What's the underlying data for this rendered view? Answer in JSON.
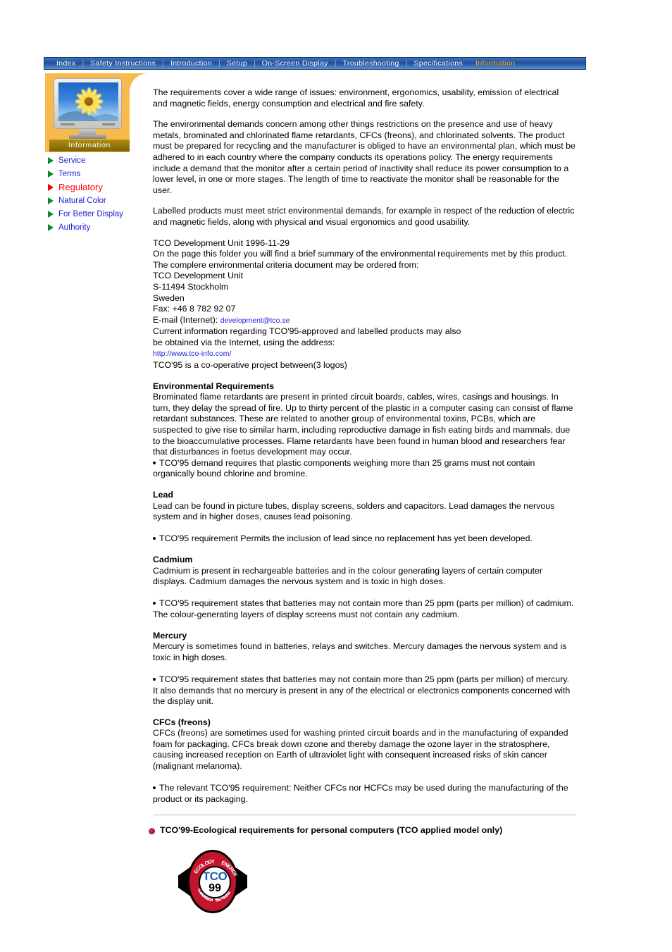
{
  "nav": {
    "items": [
      {
        "label": "Index",
        "active": false
      },
      {
        "label": "Safety Instructions",
        "active": false
      },
      {
        "label": "Introduction",
        "active": false
      },
      {
        "label": "Setup",
        "active": false
      },
      {
        "label": "On-Screen Display",
        "active": false
      },
      {
        "label": "Troubleshooting",
        "active": false
      },
      {
        "label": "Specifications",
        "active": false
      },
      {
        "label": "Information",
        "active": true
      }
    ],
    "separator": "|"
  },
  "sidebar": {
    "panel_label": "Information",
    "thumbnail_icon": "monitor-sunflower-icon",
    "items": [
      {
        "label": "Service",
        "current": false
      },
      {
        "label": "Terms",
        "current": false
      },
      {
        "label": "Regulatory",
        "current": true
      },
      {
        "label": "Natural Color",
        "current": false
      },
      {
        "label": "For Better Display",
        "current": false
      },
      {
        "label": "Authority",
        "current": false
      }
    ]
  },
  "content": {
    "p1": "The requirements cover a wide range of issues: environment, ergonomics, usability, emission of electrical and magnetic fields, energy consumption and electrical and fire safety.",
    "p2": "The environmental demands concern among other things restrictions on the presence and use of heavy metals, brominated and chlorinated flame retardants, CFCs (freons), and chlorinated solvents. The product must be prepared for recycling and the manufacturer is obliged to have an environmental plan, which must be adhered to in each country where the company conducts its operations policy. The energy requirements include a demand that the monitor after a certain period of inactivity shall reduce its power consumption to a lower level, in one or more stages. The length of time to reactivate the monitor shall be reasonable for the user.",
    "p3": "Labelled products must meet strict environmental demands, for example in respect of the reduction of electric and magnetic fields, along with physical and visual ergonomics and good usability.",
    "contact": {
      "l1": "TCO Development Unit 1996-11-29",
      "l2": "On the page this folder you will find a brief summary of the environmental requirements met by this product.",
      "l3": "The complere environmental criteria document may be ordered from:",
      "l4": "TCO Development Unit",
      "l5": "S-11494 Stockholm",
      "l6": "Sweden",
      "l7": "Fax: +46 8 782 92 07",
      "email_label": "E-mail (Internet): ",
      "email": "development@tco.se",
      "l8": "Current information regarding TCO'95-approved and labelled products may also",
      "l9": "be obtained via the Internet, using the address:",
      "url": "http://www.tco-info.com/",
      "l10": "TCO'95 is a co-operative project between(3 logos)"
    },
    "sections": [
      {
        "heading": "Environmental Requirements",
        "body": "Brominated flame retardants are present in printed circuit boards, cables, wires, casings and housings. In turn, they delay the spread of fire. Up to thirty percent of the plastic in a computer casing can consist of flame retardant substances. These are related to another group of environmental toxins, PCBs, which are suspected to give rise to similar harm, including reproductive damage in fish eating birds and mammals, due to the bioaccumulative processes. Flame retardants have been found in human blood and researchers fear that disturbances in foetus development may occur.",
        "bullet_attached": true,
        "bullet": "TCO'95 demand requires that plastic components weighing more than 25 grams must not contain organically bound chlorine and bromine."
      },
      {
        "heading": "Lead",
        "body": "Lead can be found in picture tubes, display screens, solders and capacitors. Lead damages the nervous system and in higher doses, causes lead poisoning.",
        "bullet_attached": false,
        "bullet": "TCO'95 requirement Permits the inclusion of lead since no replacement has yet been developed."
      },
      {
        "heading": "Cadmium",
        "body": "Cadmium is present in rechargeable batteries and in the colour generating layers of certain computer displays. Cadmium damages the nervous system and is toxic in high doses.",
        "bullet_attached": false,
        "bullet": "TCO'95 requirement states that batteries may not contain more than 25 ppm (parts per million) of cadmium. The colour-generating layers of display screens must not contain any cadmium."
      },
      {
        "heading": "Mercury",
        "body": "Mercury is sometimes found in batteries, relays and switches. Mercury damages the nervous system and is toxic in high doses.",
        "bullet_attached": false,
        "bullet": "TCO'95 requirement states that batteries may not contain more than 25 ppm (parts per million) of mercury. It also demands that no mercury is present in any of the electrical or electronics components concerned with the display unit."
      },
      {
        "heading": "CFCs (freons)",
        "body": "CFCs (freons) are sometimes used for washing printed circuit boards and in the manufacturing of expanded foam for packaging. CFCs break down ozone and thereby damage the ozone layer in the stratosphere, causing increased reception on Earth of ultraviolet light with consequent increased risks of skin cancer (malignant melanoma).",
        "bullet_attached": false,
        "bullet": "The relevant TCO'95 requirement: Neither CFCs nor HCFCs may be used during the manufacturing of the product or its packaging."
      }
    ],
    "tco99_heading": "TCO'99-Ecological requirements for personal computers (TCO applied model only)"
  },
  "logo": {
    "name": "tco99-certification-logo",
    "brand": "TCO",
    "year": "99",
    "arc_top": "ECOLOGY  ENERGY",
    "arc_bottom": "EMISSIONS  ERGONOMICS"
  },
  "colors": {
    "nav_blue": "#1f4f9c",
    "nav_active": "#ffb428",
    "panel_orange": "#f8b94d",
    "info_bar": "#8f7209",
    "link_blue": "#2222cc",
    "current_red": "#ff0000",
    "tri_green": "#0a8a2a",
    "logo_red": "#c3142e",
    "logo_blue": "#1c5fae",
    "maroon_dot": "#8b0020"
  }
}
